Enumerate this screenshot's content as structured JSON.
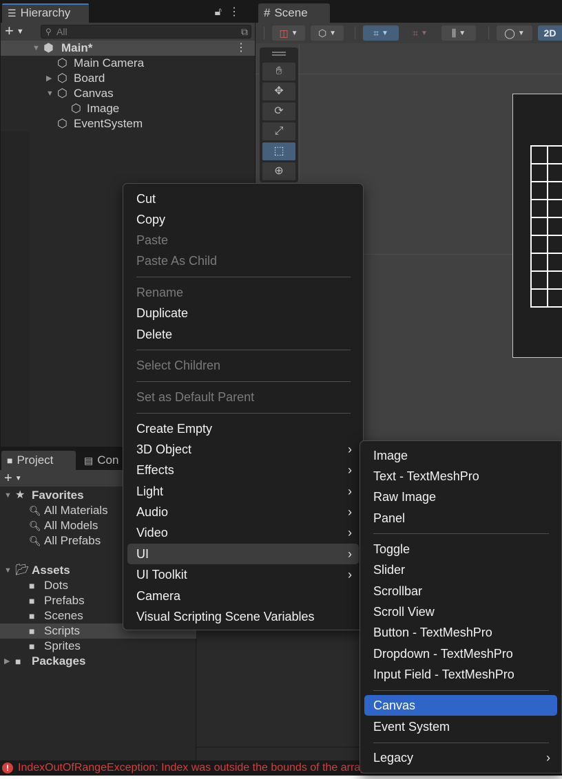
{
  "hierarchy": {
    "tab_label": "Hierarchy",
    "search_placeholder": "All",
    "scene_root": "Main*",
    "items": [
      "Main Camera",
      "Board",
      "Canvas",
      "Image",
      "EventSystem"
    ]
  },
  "scene": {
    "tab_label": "Scene",
    "mode_2d": "2D"
  },
  "context_menu": {
    "items": [
      {
        "label": "Cut",
        "enabled": true
      },
      {
        "label": "Copy",
        "enabled": true
      },
      {
        "label": "Paste",
        "enabled": false
      },
      {
        "label": "Paste As Child",
        "enabled": false
      },
      {
        "label": "Rename",
        "enabled": false
      },
      {
        "label": "Duplicate",
        "enabled": true
      },
      {
        "label": "Delete",
        "enabled": true
      },
      {
        "label": "Select Children",
        "enabled": false
      },
      {
        "label": "Set as Default Parent",
        "enabled": false
      },
      {
        "label": "Create Empty",
        "enabled": true
      },
      {
        "label": "3D Object",
        "enabled": true,
        "submenu": true
      },
      {
        "label": "Effects",
        "enabled": true,
        "submenu": true
      },
      {
        "label": "Light",
        "enabled": true,
        "submenu": true
      },
      {
        "label": "Audio",
        "enabled": true,
        "submenu": true
      },
      {
        "label": "Video",
        "enabled": true,
        "submenu": true
      },
      {
        "label": "UI",
        "enabled": true,
        "submenu": true,
        "highlighted": true
      },
      {
        "label": "UI Toolkit",
        "enabled": true,
        "submenu": true
      },
      {
        "label": "Camera",
        "enabled": true
      },
      {
        "label": "Visual Scripting Scene Variables",
        "enabled": true
      }
    ]
  },
  "ui_submenu": {
    "items": [
      {
        "label": "Image"
      },
      {
        "label": "Text - TextMeshPro"
      },
      {
        "label": "Raw Image"
      },
      {
        "label": "Panel"
      },
      {
        "label": "Toggle"
      },
      {
        "label": "Slider"
      },
      {
        "label": "Scrollbar"
      },
      {
        "label": "Scroll View"
      },
      {
        "label": "Button - TextMeshPro"
      },
      {
        "label": "Dropdown - TextMeshPro"
      },
      {
        "label": "Input Field - TextMeshPro"
      },
      {
        "label": "Canvas",
        "selected": true
      },
      {
        "label": "Event System"
      },
      {
        "label": "Legacy",
        "submenu": true
      }
    ]
  },
  "project": {
    "tab_label": "Project",
    "tab2_label": "Con",
    "favorites_label": "Favorites",
    "favorites": [
      "All Materials",
      "All Models",
      "All Prefabs"
    ],
    "assets_label": "Assets",
    "assets": [
      "Dots",
      "Prefabs",
      "Scenes",
      "Scripts",
      "Sprites"
    ],
    "selected_asset": "Scripts",
    "packages_label": "Packages"
  },
  "status": {
    "error_text": "IndexOutOfRangeException: Index was outside the bounds of the array."
  },
  "colors": {
    "selection": "#2f64c8",
    "error": "#d43e3e",
    "panel_bg": "#282828"
  }
}
